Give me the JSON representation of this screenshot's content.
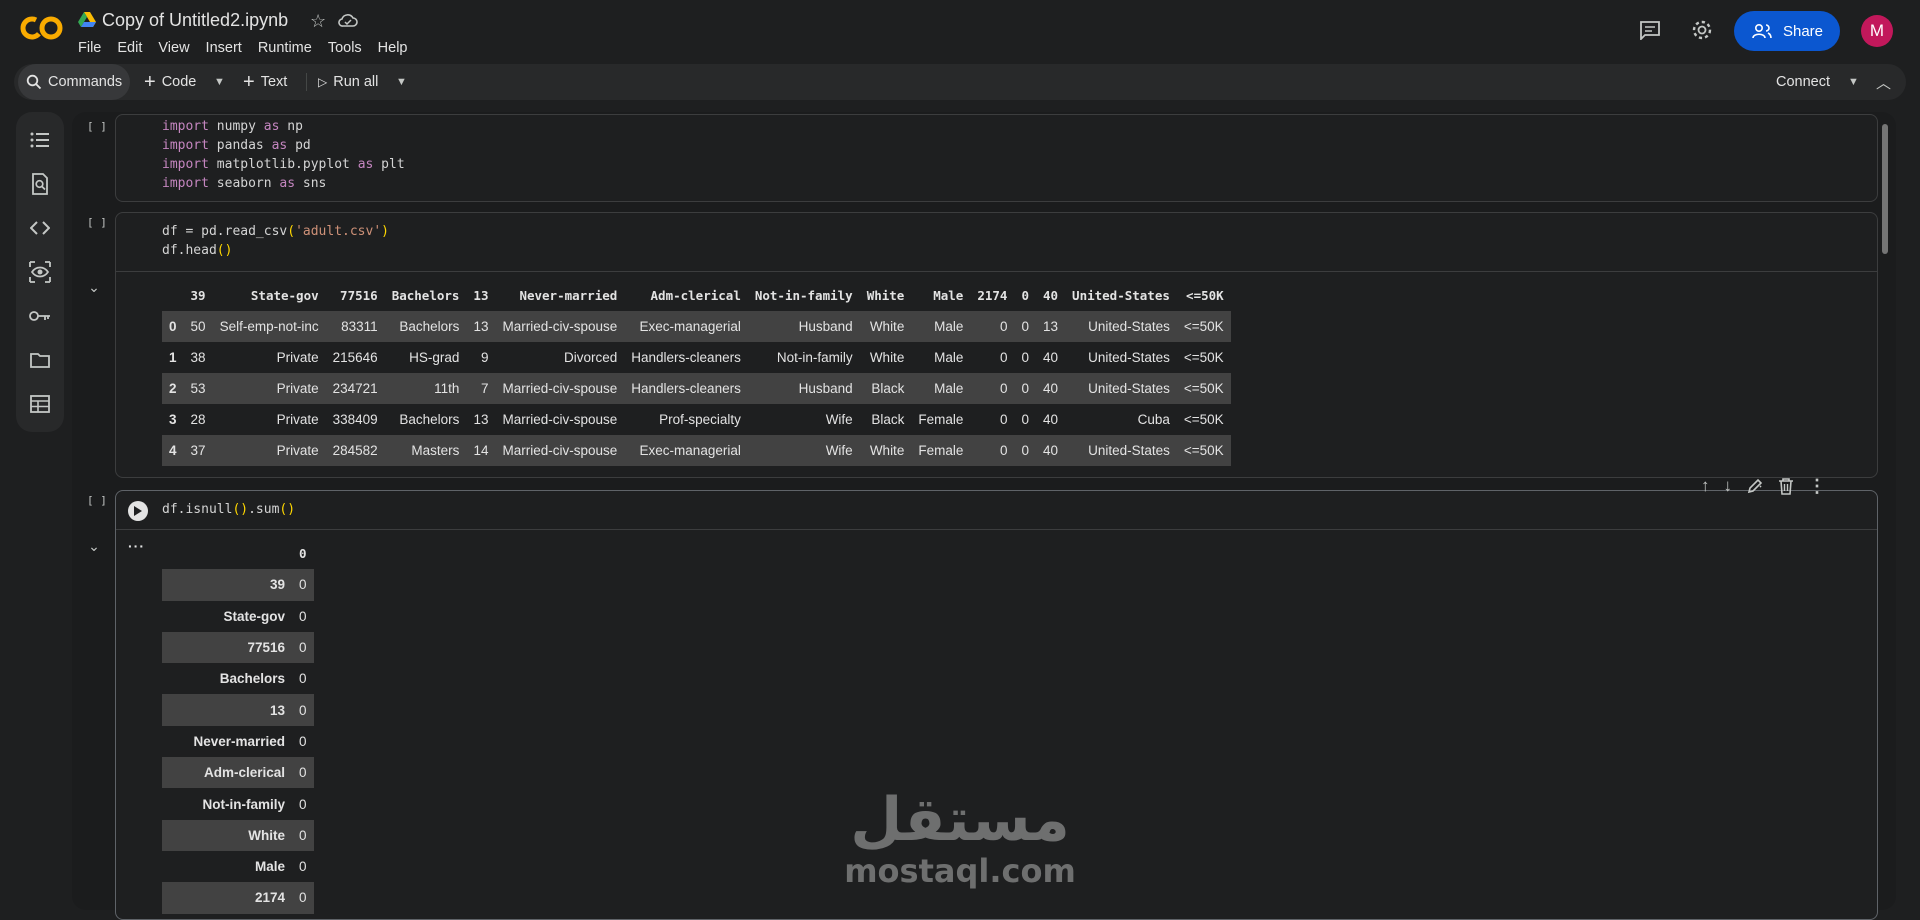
{
  "app": {
    "title": "Copy of Untitled2.ipynb",
    "menu": [
      "File",
      "Edit",
      "View",
      "Insert",
      "Runtime",
      "Tools",
      "Help"
    ],
    "share_label": "Share",
    "avatar_letter": "M"
  },
  "toolbar": {
    "commands_label": "Commands",
    "code_label": "Code",
    "text_label": "Text",
    "run_all_label": "Run all",
    "connect_label": "Connect"
  },
  "cells": {
    "c1": {
      "bracket": "[ ]",
      "lines": [
        "import numpy as np",
        "import pandas as pd",
        "import matplotlib.pyplot as plt",
        "import seaborn as sns"
      ]
    },
    "c2": {
      "bracket": "[ ]",
      "line1": "df = pd.read_csv('adult.csv')",
      "line2": "df.head()"
    },
    "c3": {
      "bracket": "[ ]",
      "line1": "df.isnull().sum()"
    }
  },
  "head_table": {
    "columns": [
      "",
      "39",
      "State-gov",
      "77516",
      "Bachelors",
      "13",
      "Never-married",
      "Adm-clerical",
      "Not-in-family",
      "White",
      "Male",
      "2174",
      "0",
      "40",
      "United-States",
      "<=50K"
    ],
    "rows": [
      [
        "0",
        "50",
        "Self-emp-not-inc",
        "83311",
        "Bachelors",
        "13",
        "Married-civ-spouse",
        "Exec-managerial",
        "Husband",
        "White",
        "Male",
        "0",
        "0",
        "13",
        "United-States",
        "<=50K"
      ],
      [
        "1",
        "38",
        "Private",
        "215646",
        "HS-grad",
        "9",
        "Divorced",
        "Handlers-cleaners",
        "Not-in-family",
        "White",
        "Male",
        "0",
        "0",
        "40",
        "United-States",
        "<=50K"
      ],
      [
        "2",
        "53",
        "Private",
        "234721",
        "11th",
        "7",
        "Married-civ-spouse",
        "Handlers-cleaners",
        "Husband",
        "Black",
        "Male",
        "0",
        "0",
        "40",
        "United-States",
        "<=50K"
      ],
      [
        "3",
        "28",
        "Private",
        "338409",
        "Bachelors",
        "13",
        "Married-civ-spouse",
        "Prof-specialty",
        "Wife",
        "Black",
        "Female",
        "0",
        "0",
        "40",
        "Cuba",
        "<=50K"
      ],
      [
        "4",
        "37",
        "Private",
        "284582",
        "Masters",
        "14",
        "Married-civ-spouse",
        "Exec-managerial",
        "Wife",
        "White",
        "Female",
        "0",
        "0",
        "40",
        "United-States",
        "<=50K"
      ]
    ]
  },
  "null_table": {
    "header": "0",
    "rows": [
      [
        "39",
        "0"
      ],
      [
        "State-gov",
        "0"
      ],
      [
        "77516",
        "0"
      ],
      [
        "Bachelors",
        "0"
      ],
      [
        "13",
        "0"
      ],
      [
        "Never-married",
        "0"
      ],
      [
        "Adm-clerical",
        "0"
      ],
      [
        "Not-in-family",
        "0"
      ],
      [
        "White",
        "0"
      ],
      [
        "Male",
        "0"
      ],
      [
        "2174",
        "0"
      ]
    ]
  },
  "watermark": {
    "arabic": "مستقل",
    "latin": "mostaql.com"
  },
  "colors": {
    "accent": "#0b57d0",
    "avatar": "#c2185b",
    "logo_orange": "#f9ab00",
    "logo_yellow": "#e37400"
  }
}
